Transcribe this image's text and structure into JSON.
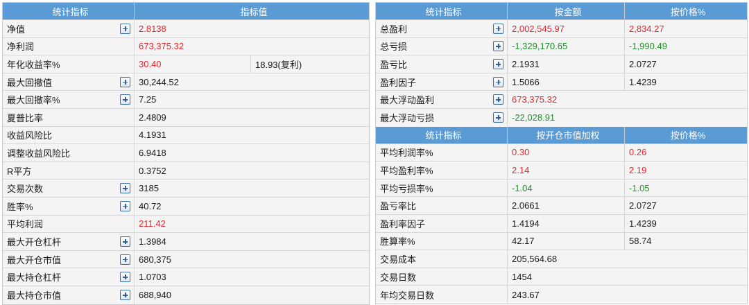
{
  "left": {
    "headers": [
      "统计指标",
      "指标值"
    ],
    "rows": [
      {
        "label": "净值",
        "value": "2.8138",
        "expand": true,
        "color": "red"
      },
      {
        "label": "净利润",
        "value": "673,375.32",
        "expand": false,
        "color": "red"
      },
      {
        "label": "年化收益率%",
        "value": "30.40",
        "value2": "18.93(复利)",
        "expand": false,
        "color": "red"
      },
      {
        "label": "最大回撤值",
        "value": "30,244.52",
        "expand": true
      },
      {
        "label": "最大回撤率%",
        "value": "7.25",
        "expand": true
      },
      {
        "label": "夏普比率",
        "value": "2.4809",
        "expand": false
      },
      {
        "label": "收益风险比",
        "value": "4.1931",
        "expand": false
      },
      {
        "label": "调整收益风险比",
        "value": "6.9418",
        "expand": false
      },
      {
        "label": "R平方",
        "value": "0.3752",
        "expand": false
      },
      {
        "label": "交易次数",
        "value": "3185",
        "expand": true
      },
      {
        "label": "胜率%",
        "value": "40.72",
        "expand": true
      },
      {
        "label": "平均利润",
        "value": "211.42",
        "expand": false,
        "color": "red"
      },
      {
        "label": "最大开仓杠杆",
        "value": "1.3984",
        "expand": true
      },
      {
        "label": "最大开仓市值",
        "value": "680,375",
        "expand": true
      },
      {
        "label": "最大持仓杠杆",
        "value": "1.0703",
        "expand": true
      },
      {
        "label": "最大持仓市值",
        "value": "688,940",
        "expand": true
      }
    ]
  },
  "right": {
    "headers1": [
      "统计指标",
      "按金额",
      "按价格%"
    ],
    "rows1": [
      {
        "label": "总盈利",
        "v1": "2,002,545.97",
        "v2": "2,834.27",
        "expand": true,
        "c1": "red",
        "c2": "red"
      },
      {
        "label": "总亏损",
        "v1": "-1,329,170.65",
        "v2": "-1,990.49",
        "expand": true,
        "c1": "green",
        "c2": "green"
      },
      {
        "label": "盈亏比",
        "v1": "2.1931",
        "v2": "2.0727",
        "expand": true
      },
      {
        "label": "盈利因子",
        "v1": "1.5066",
        "v2": "1.4239",
        "expand": true
      },
      {
        "label": "最大浮动盈利",
        "v1": "673,375.32",
        "expand": true,
        "c1": "red",
        "span": true
      },
      {
        "label": "最大浮动亏损",
        "v1": "-22,028.91",
        "expand": true,
        "c1": "green",
        "span": true
      }
    ],
    "headers2": [
      "统计指标",
      "按开仓市值加权",
      "按价格%"
    ],
    "rows2": [
      {
        "label": "平均利润率%",
        "v1": "0.30",
        "v2": "0.26",
        "c1": "red",
        "c2": "red"
      },
      {
        "label": "平均盈利率%",
        "v1": "2.14",
        "v2": "2.19",
        "c1": "red",
        "c2": "red"
      },
      {
        "label": "平均亏损率%",
        "v1": "-1.04",
        "v2": "-1.05",
        "c1": "green",
        "c2": "green"
      },
      {
        "label": "盈亏率比",
        "v1": "2.0661",
        "v2": "2.0727"
      },
      {
        "label": "盈利率因子",
        "v1": "1.4194",
        "v2": "1.4239"
      },
      {
        "label": "胜算率%",
        "v1": "42.17",
        "v2": "58.74"
      },
      {
        "label": "交易成本",
        "v1": "205,564.68",
        "span": true
      },
      {
        "label": "交易日数",
        "v1": "1454",
        "span": true
      },
      {
        "label": "年均交易日数",
        "v1": "243.67",
        "span": true
      }
    ]
  }
}
